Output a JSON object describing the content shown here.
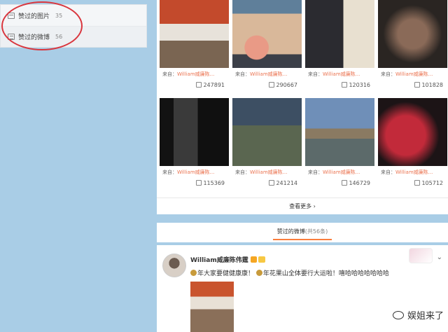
{
  "sidebar": {
    "items": [
      {
        "label": "赞过的图片",
        "count": "35",
        "icon": "picture-icon"
      },
      {
        "label": "赞过的微博",
        "count": "56",
        "icon": "document-icon"
      }
    ]
  },
  "photos": [
    {
      "from_label": "来自：",
      "source": "William威廉陈...",
      "likes": "247891"
    },
    {
      "from_label": "来自：",
      "source": "William威廉陈...",
      "likes": "290667"
    },
    {
      "from_label": "来自：",
      "source": "William威廉陈...",
      "likes": "120316"
    },
    {
      "from_label": "来自：",
      "source": "William威廉陈...",
      "likes": "101828"
    },
    {
      "from_label": "来自：",
      "source": "William威廉陈...",
      "likes": "115369"
    },
    {
      "from_label": "来自：",
      "source": "William威廉陈...",
      "likes": "241214"
    },
    {
      "from_label": "来自：",
      "source": "William威廉陈...",
      "likes": "146729"
    },
    {
      "from_label": "来自：",
      "source": "William威廉陈...",
      "likes": "105712"
    }
  ],
  "more_label": "查看更多 ›",
  "tabs": {
    "active_label": "赞过的微博",
    "count_label": "(共56条)"
  },
  "post": {
    "author": "William威廉陈伟霆",
    "text_part1": "年大家要健健康康！",
    "text_part2": "年花果山全体要行大运啦！嘻哈哈哈哈哈哈哈",
    "chevron": "⌄"
  },
  "watermark": "娱姐来了",
  "colors": {
    "background": "#a9cde6",
    "accent": "#eb7350",
    "highlight_circle": "#d9363e"
  }
}
